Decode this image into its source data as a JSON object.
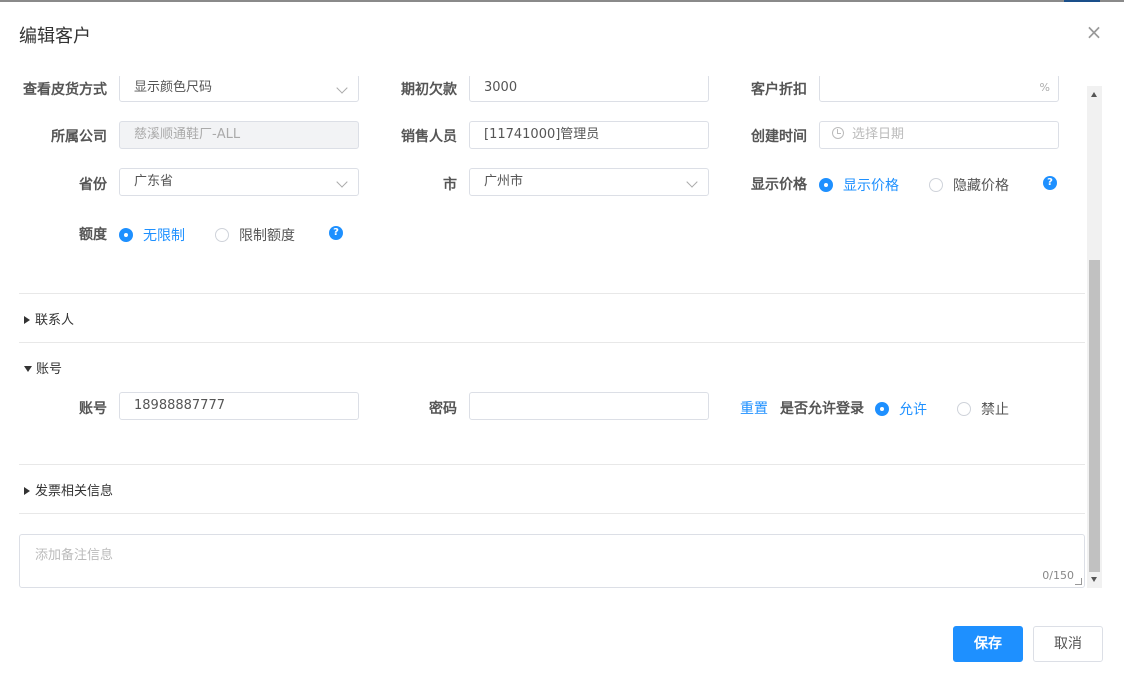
{
  "dialog": {
    "title": "编辑客户",
    "close_glyph": "×"
  },
  "form": {
    "row_partial": {
      "col1": {
        "label": "查看皮货方式",
        "value": "显示颜色尺码"
      },
      "col2": {
        "label": "期初欠款",
        "value": "3000"
      },
      "col3": {
        "label": "客户折扣",
        "suffix": "%"
      }
    },
    "company": {
      "label": "所属公司",
      "value": "慈溪顺通鞋厂-ALL"
    },
    "salesperson": {
      "label": "销售人员",
      "value": "[11741000]管理员"
    },
    "created": {
      "label": "创建时间",
      "placeholder": "选择日期"
    },
    "province": {
      "label": "省份",
      "value": "广东省"
    },
    "city": {
      "label": "市",
      "value": "广州市"
    },
    "show_price": {
      "label": "显示价格",
      "options": [
        {
          "label": "显示价格",
          "checked": true
        },
        {
          "label": "隐藏价格",
          "checked": false
        }
      ],
      "help": "?"
    },
    "quota": {
      "label": "额度",
      "options": [
        {
          "label": "无限制",
          "checked": true
        },
        {
          "label": "限制额度",
          "checked": false
        }
      ],
      "help": "?"
    }
  },
  "sections": {
    "contacts": {
      "title": "联系人"
    },
    "account": {
      "title": "账号"
    },
    "invoice": {
      "title": "发票相关信息"
    }
  },
  "account": {
    "account_label": "账号",
    "account_value": "18988887777",
    "password_label": "密码",
    "password_value": "",
    "reset_label": "重置",
    "allow_login_label": "是否允许登录",
    "login_options": [
      {
        "label": "允许",
        "checked": true
      },
      {
        "label": "禁止",
        "checked": false
      }
    ]
  },
  "remark": {
    "placeholder": "添加备注信息",
    "counter": "0/150"
  },
  "footer": {
    "save_label": "保存",
    "cancel_label": "取消"
  },
  "colors": {
    "primary": "#1e90ff",
    "border": "#dcdfe6",
    "disabled_bg": "#f2f3f5"
  }
}
